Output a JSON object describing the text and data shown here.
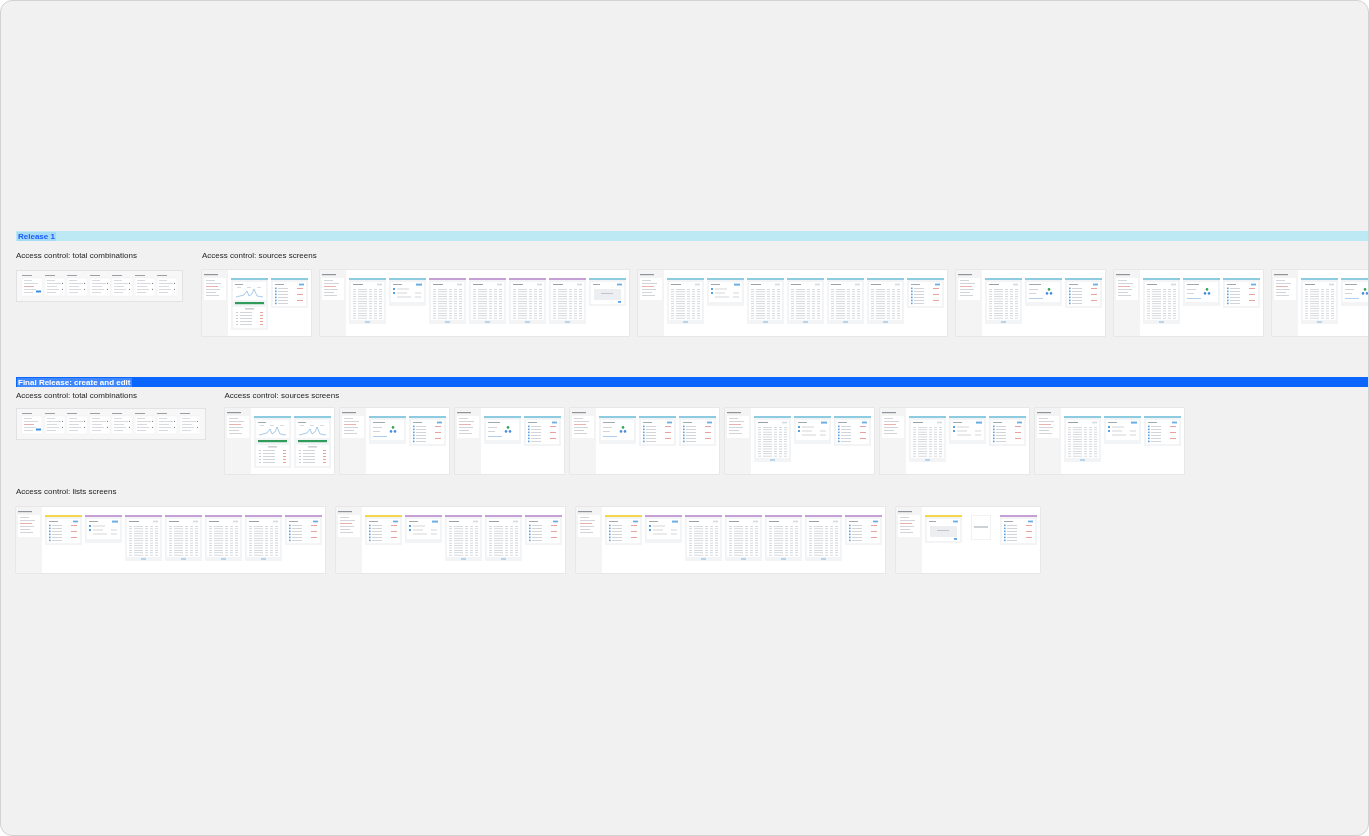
{
  "sections": [
    {
      "title": "Release 1",
      "kind": "light",
      "rows": [
        {
          "groups": [
            {
              "label": "Access control: total combinations",
              "boards": [
                {
                  "kind": "combinations",
                  "cards": [
                    {
                      "kind": "summary"
                    },
                    {
                      "kind": "option"
                    },
                    {
                      "kind": "option"
                    },
                    {
                      "kind": "option"
                    },
                    {
                      "kind": "option"
                    },
                    {
                      "kind": "option"
                    },
                    {
                      "kind": "option"
                    }
                  ]
                }
              ]
            },
            {
              "label": "Access control: sources screens",
              "boards": [
                {
                  "kind": "screens",
                  "screens": [
                    {
                      "kind": "chart",
                      "color": "#8ccbe0"
                    },
                    {
                      "kind": "list",
                      "color": "#8ccbe0"
                    }
                  ]
                },
                {
                  "kind": "screens",
                  "screens": [
                    {
                      "kind": "table",
                      "color": "#8ccbe0"
                    },
                    {
                      "kind": "form",
                      "color": "#8ccbe0"
                    },
                    {
                      "kind": "table",
                      "color": "#c59fd6"
                    },
                    {
                      "kind": "table",
                      "color": "#c59fd6"
                    },
                    {
                      "kind": "table",
                      "color": "#c59fd6"
                    },
                    {
                      "kind": "table",
                      "color": "#c59fd6"
                    },
                    {
                      "kind": "dialog",
                      "color": "#8ccbe0"
                    }
                  ]
                },
                {
                  "kind": "screens",
                  "screens": [
                    {
                      "kind": "table",
                      "color": "#8ccbe0"
                    },
                    {
                      "kind": "form",
                      "color": "#8ccbe0"
                    },
                    {
                      "kind": "table",
                      "color": "#8ccbe0"
                    },
                    {
                      "kind": "table",
                      "color": "#8ccbe0"
                    },
                    {
                      "kind": "table",
                      "color": "#8ccbe0"
                    },
                    {
                      "kind": "table",
                      "color": "#8ccbe0"
                    },
                    {
                      "kind": "list",
                      "color": "#8ccbe0"
                    }
                  ]
                },
                {
                  "kind": "screens",
                  "screens": [
                    {
                      "kind": "table",
                      "color": "#8ccbe0"
                    },
                    {
                      "kind": "toggles",
                      "color": "#8ccbe0"
                    },
                    {
                      "kind": "list",
                      "color": "#8ccbe0"
                    }
                  ]
                },
                {
                  "kind": "screens",
                  "screens": [
                    {
                      "kind": "table",
                      "color": "#8ccbe0"
                    },
                    {
                      "kind": "toggles",
                      "color": "#8ccbe0"
                    },
                    {
                      "kind": "list",
                      "color": "#8ccbe0"
                    }
                  ]
                },
                {
                  "kind": "screens",
                  "screens": [
                    {
                      "kind": "table",
                      "color": "#8ccbe0"
                    },
                    {
                      "kind": "toggles",
                      "color": "#8ccbe0"
                    }
                  ]
                }
              ]
            }
          ]
        }
      ]
    },
    {
      "title": "Final Release: create and edit",
      "kind": "solid",
      "rows": [
        {
          "groups": [
            {
              "label": "Access control: total combinations",
              "boards": [
                {
                  "kind": "combinations",
                  "cards": [
                    {
                      "kind": "summary"
                    },
                    {
                      "kind": "option"
                    },
                    {
                      "kind": "option"
                    },
                    {
                      "kind": "option"
                    },
                    {
                      "kind": "option"
                    },
                    {
                      "kind": "option"
                    },
                    {
                      "kind": "option"
                    },
                    {
                      "kind": "option"
                    }
                  ]
                }
              ]
            },
            {
              "label": "Access control: sources screens",
              "boards": [
                {
                  "kind": "screens",
                  "screens": [
                    {
                      "kind": "chart",
                      "color": "#8ccbe0"
                    },
                    {
                      "kind": "chart",
                      "color": "#8ccbe0"
                    }
                  ]
                },
                {
                  "kind": "screens",
                  "screens": [
                    {
                      "kind": "toggles",
                      "color": "#8ccbe0"
                    },
                    {
                      "kind": "list",
                      "color": "#8ccbe0"
                    }
                  ]
                },
                {
                  "kind": "screens",
                  "screens": [
                    {
                      "kind": "toggles",
                      "color": "#8ccbe0"
                    },
                    {
                      "kind": "list",
                      "color": "#8ccbe0"
                    }
                  ]
                },
                {
                  "kind": "screens",
                  "screens": [
                    {
                      "kind": "toggles",
                      "color": "#8ccbe0"
                    },
                    {
                      "kind": "list",
                      "color": "#8ccbe0"
                    },
                    {
                      "kind": "list",
                      "color": "#8ccbe0"
                    }
                  ]
                },
                {
                  "kind": "screens",
                  "screens": [
                    {
                      "kind": "table",
                      "color": "#8ccbe0"
                    },
                    {
                      "kind": "form",
                      "color": "#8ccbe0"
                    },
                    {
                      "kind": "list",
                      "color": "#8ccbe0"
                    }
                  ]
                },
                {
                  "kind": "screens",
                  "screens": [
                    {
                      "kind": "table",
                      "color": "#8ccbe0"
                    },
                    {
                      "kind": "form",
                      "color": "#8ccbe0"
                    },
                    {
                      "kind": "list",
                      "color": "#8ccbe0"
                    }
                  ]
                },
                {
                  "kind": "screens",
                  "screens": [
                    {
                      "kind": "table",
                      "color": "#8ccbe0"
                    },
                    {
                      "kind": "form",
                      "color": "#8ccbe0"
                    },
                    {
                      "kind": "list",
                      "color": "#8ccbe0"
                    }
                  ]
                }
              ]
            }
          ]
        },
        {
          "groups": [
            {
              "label": "Access control: lists screens",
              "boards": [
                {
                  "kind": "screens",
                  "screens": [
                    {
                      "kind": "list",
                      "color": "#f3d64b"
                    },
                    {
                      "kind": "form",
                      "color": "#c59fd6"
                    },
                    {
                      "kind": "table",
                      "color": "#c59fd6"
                    },
                    {
                      "kind": "table",
                      "color": "#c59fd6"
                    },
                    {
                      "kind": "table",
                      "color": "#c59fd6"
                    },
                    {
                      "kind": "table",
                      "color": "#c59fd6"
                    },
                    {
                      "kind": "list",
                      "color": "#c59fd6"
                    }
                  ]
                },
                {
                  "kind": "screens",
                  "screens": [
                    {
                      "kind": "list",
                      "color": "#f3d64b"
                    },
                    {
                      "kind": "form",
                      "color": "#c59fd6"
                    },
                    {
                      "kind": "table",
                      "color": "#c59fd6"
                    },
                    {
                      "kind": "table",
                      "color": "#c59fd6"
                    },
                    {
                      "kind": "list",
                      "color": "#c59fd6"
                    }
                  ]
                },
                {
                  "kind": "screens",
                  "screens": [
                    {
                      "kind": "list",
                      "color": "#f3d64b"
                    },
                    {
                      "kind": "form",
                      "color": "#c59fd6"
                    },
                    {
                      "kind": "table",
                      "color": "#c59fd6"
                    },
                    {
                      "kind": "table",
                      "color": "#c59fd6"
                    },
                    {
                      "kind": "table",
                      "color": "#c59fd6"
                    },
                    {
                      "kind": "table",
                      "color": "#c59fd6"
                    },
                    {
                      "kind": "list",
                      "color": "#c59fd6"
                    }
                  ]
                },
                {
                  "kind": "screens",
                  "screens": [
                    {
                      "kind": "dialog",
                      "color": "#f3d64b"
                    },
                    {
                      "kind": "note"
                    },
                    {
                      "kind": "list",
                      "color": "#c59fd6"
                    }
                  ]
                }
              ]
            }
          ]
        }
      ]
    }
  ]
}
